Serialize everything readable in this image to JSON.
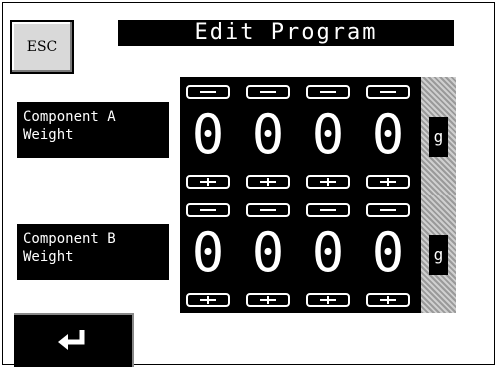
{
  "header": {
    "esc_label": "ESC",
    "title": "Edit Program"
  },
  "components": [
    {
      "label": "Component A\nWeight",
      "digits": [
        "0",
        "0",
        "0",
        "0"
      ],
      "unit": "g"
    },
    {
      "label": "Component B\nWeight",
      "digits": [
        "0",
        "0",
        "0",
        "0"
      ],
      "unit": "g"
    }
  ],
  "icons": {
    "enter": "enter-return-icon",
    "minus": "minus-icon",
    "plus": "plus-icon"
  }
}
